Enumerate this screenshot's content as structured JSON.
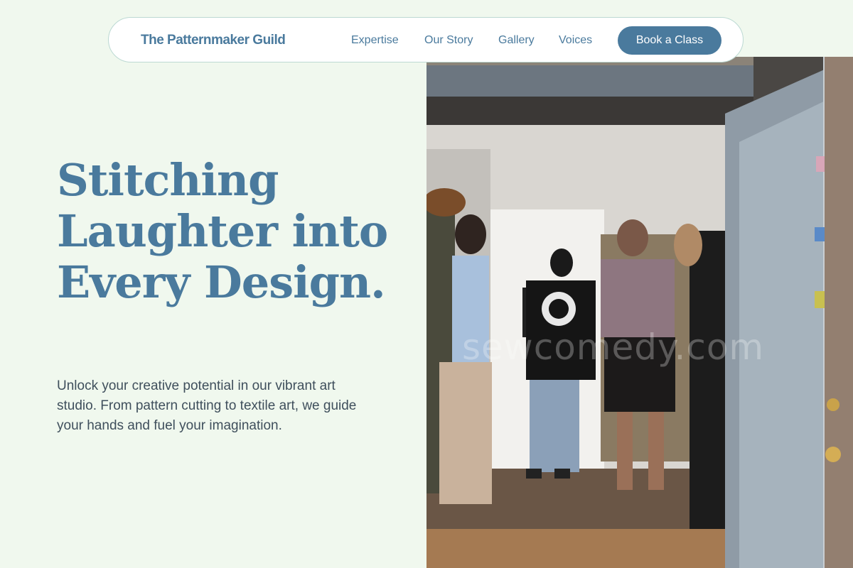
{
  "nav": {
    "brand": "The Patternmaker Guild",
    "links": [
      "Expertise",
      "Our Story",
      "Gallery",
      "Voices"
    ],
    "cta_label": "Book a Class"
  },
  "hero": {
    "headline": "Stitching Laughter into Every Design.",
    "subtext": "Unlock your creative potential in our vibrant art studio. From pattern cutting to textile art, we guide your hands and fuel your imagination.",
    "watermark": "sewcomedy.com"
  },
  "colors": {
    "background": "#f0f8ee",
    "accent": "#4a7a9d",
    "body_text": "#3f4f5c"
  }
}
